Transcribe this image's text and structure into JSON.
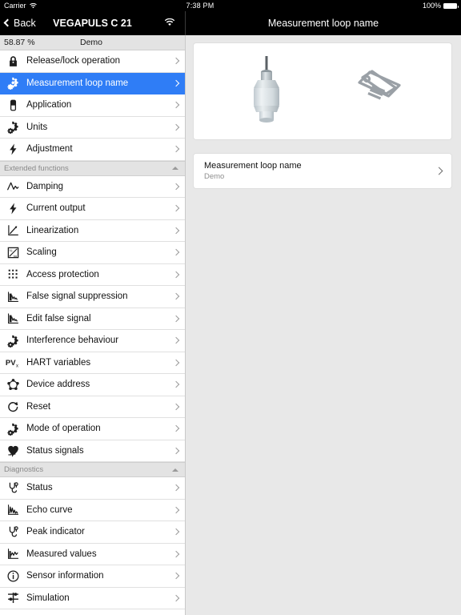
{
  "status_bar": {
    "carrier": "Carrier",
    "wifi_icon": "wifi-icon",
    "time": "7:38 PM",
    "battery_percent": "100%",
    "battery_icon": "battery-full-icon"
  },
  "nav": {
    "back_label": "Back",
    "device_title": "VEGAPULS C 21",
    "wifi_icon": "wifi-icon",
    "detail_title": "Measurement loop name"
  },
  "subheader": {
    "value": "58.87 %",
    "loop_name": "Demo"
  },
  "sidebar": {
    "sections": [
      {
        "header": null,
        "items": [
          {
            "label": "Release/lock operation",
            "icon": "lock-icon",
            "selected": false
          },
          {
            "label": "Measurement loop name",
            "icon": "gears-icon",
            "selected": true
          },
          {
            "label": "Application",
            "icon": "sensor-icon",
            "selected": false
          },
          {
            "label": "Units",
            "icon": "gears-icon",
            "selected": false
          },
          {
            "label": "Adjustment",
            "icon": "bolt-icon",
            "selected": false
          }
        ]
      },
      {
        "header": "Extended functions",
        "collapse_icon": "chevron-up-icon",
        "items": [
          {
            "label": "Damping",
            "icon": "waveform-icon",
            "selected": false
          },
          {
            "label": "Current output",
            "icon": "bolt-icon",
            "selected": false
          },
          {
            "label": "Linearization",
            "icon": "linear-chart-icon",
            "selected": false
          },
          {
            "label": "Scaling",
            "icon": "scaling-icon",
            "selected": false
          },
          {
            "label": "Access protection",
            "icon": "keypad-icon",
            "selected": false
          },
          {
            "label": "False signal suppression",
            "icon": "signal-curve-icon",
            "selected": false
          },
          {
            "label": "Edit false signal",
            "icon": "signal-curve-icon",
            "selected": false
          },
          {
            "label": "Interference behaviour",
            "icon": "gears-icon",
            "selected": false
          },
          {
            "label": "HART variables",
            "icon": "pv-x-icon",
            "selected": false
          },
          {
            "label": "Device address",
            "icon": "network-nodes-icon",
            "selected": false
          },
          {
            "label": "Reset",
            "icon": "reset-arrow-icon",
            "selected": false
          },
          {
            "label": "Mode of operation",
            "icon": "gears-icon",
            "selected": false
          },
          {
            "label": "Status signals",
            "icon": "heart-pulse-icon",
            "selected": false
          }
        ]
      },
      {
        "header": "Diagnostics",
        "collapse_icon": "chevron-up-icon",
        "items": [
          {
            "label": "Status",
            "icon": "stethoscope-icon",
            "selected": false
          },
          {
            "label": "Echo curve",
            "icon": "echo-curve-icon",
            "selected": false
          },
          {
            "label": "Peak indicator",
            "icon": "stethoscope-icon",
            "selected": false
          },
          {
            "label": "Measured values",
            "icon": "measured-chart-icon",
            "selected": false
          },
          {
            "label": "Sensor information",
            "icon": "info-circle-icon",
            "selected": false
          },
          {
            "label": "Simulation",
            "icon": "slider-icon",
            "selected": false
          }
        ]
      }
    ]
  },
  "detail": {
    "hero": {
      "device_image": "vegapuls-sensor-image",
      "tag_icon": "price-tag-icon"
    },
    "row": {
      "title": "Measurement loop name",
      "value": "Demo",
      "arrow_icon": "chevron-right-icon"
    }
  },
  "colors": {
    "accent": "#2f7df6",
    "status_bar": "#000000",
    "pane_background": "#e8e8e8",
    "card": "#ffffff",
    "section_header_text": "#8a8a8a"
  }
}
